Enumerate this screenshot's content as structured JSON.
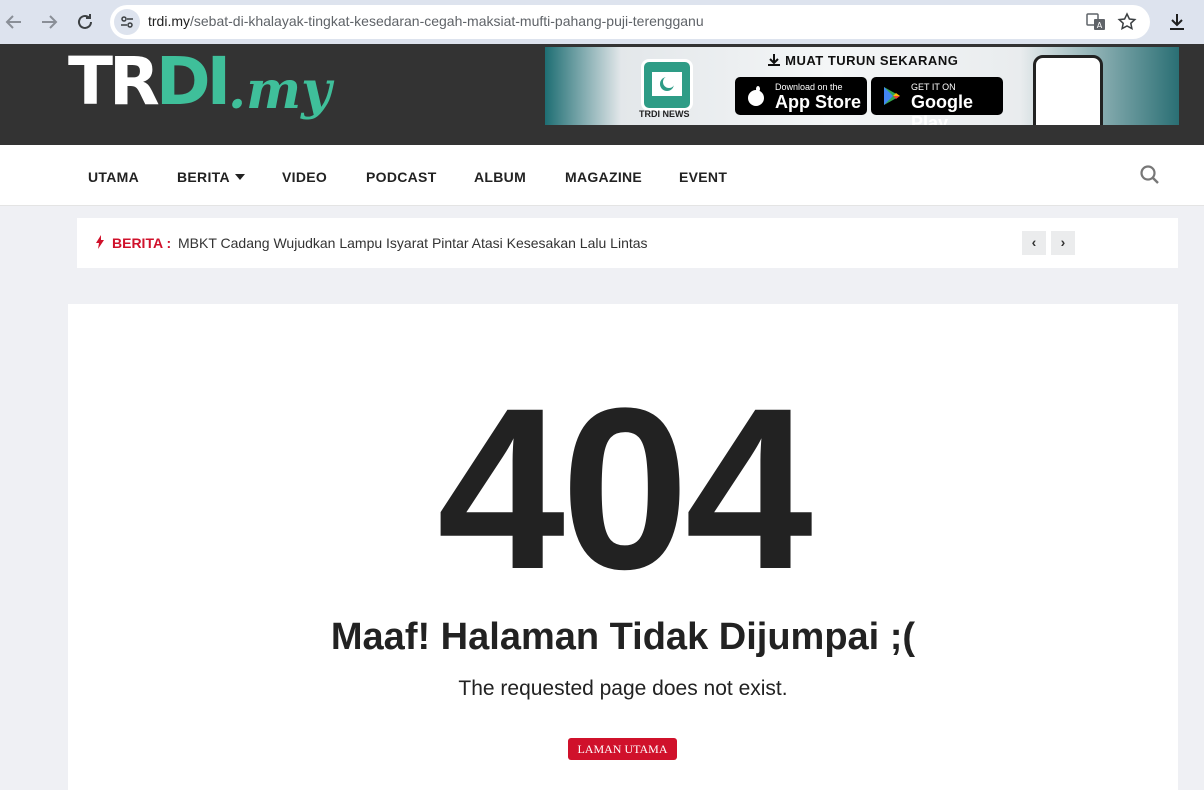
{
  "browser": {
    "url_host": "trdi.my",
    "url_path": "/sebat-di-khalayak-tingkat-kesedaran-cegah-maksiat-mufti-pahang-puji-terengganu"
  },
  "header": {
    "logo_text_1": "TR",
    "logo_text_2": "DI",
    "logo_suffix": ".my",
    "banner": {
      "title": "MUAT TURUN SEKARANG",
      "app_label": "TRDI NEWS",
      "appstore_small": "Download on the",
      "appstore_big": "App Store",
      "googleplay_small": "GET IT ON",
      "googleplay_big": "Google Play"
    }
  },
  "menu": {
    "items": [
      "UTAMA",
      "BERITA",
      "VIDEO",
      "PODCAST",
      "ALBUM",
      "MAGAZINE",
      "EVENT"
    ]
  },
  "ticker": {
    "label": "BERITA :",
    "headline": "MBKT Cadang Wujudkan Lampu Isyarat Pintar Atasi Kesesakan Lalu Lintas",
    "prev": "‹",
    "next": "›"
  },
  "error": {
    "code": "404",
    "title": "Maaf! Halaman Tidak Dijumpai ;(",
    "subtitle": "The requested page does not exist.",
    "home_button": "LAMAN UTAMA"
  },
  "colors": {
    "accent_red": "#d0112b",
    "brand_green": "#3fbf9a",
    "header_dark": "#333333"
  }
}
